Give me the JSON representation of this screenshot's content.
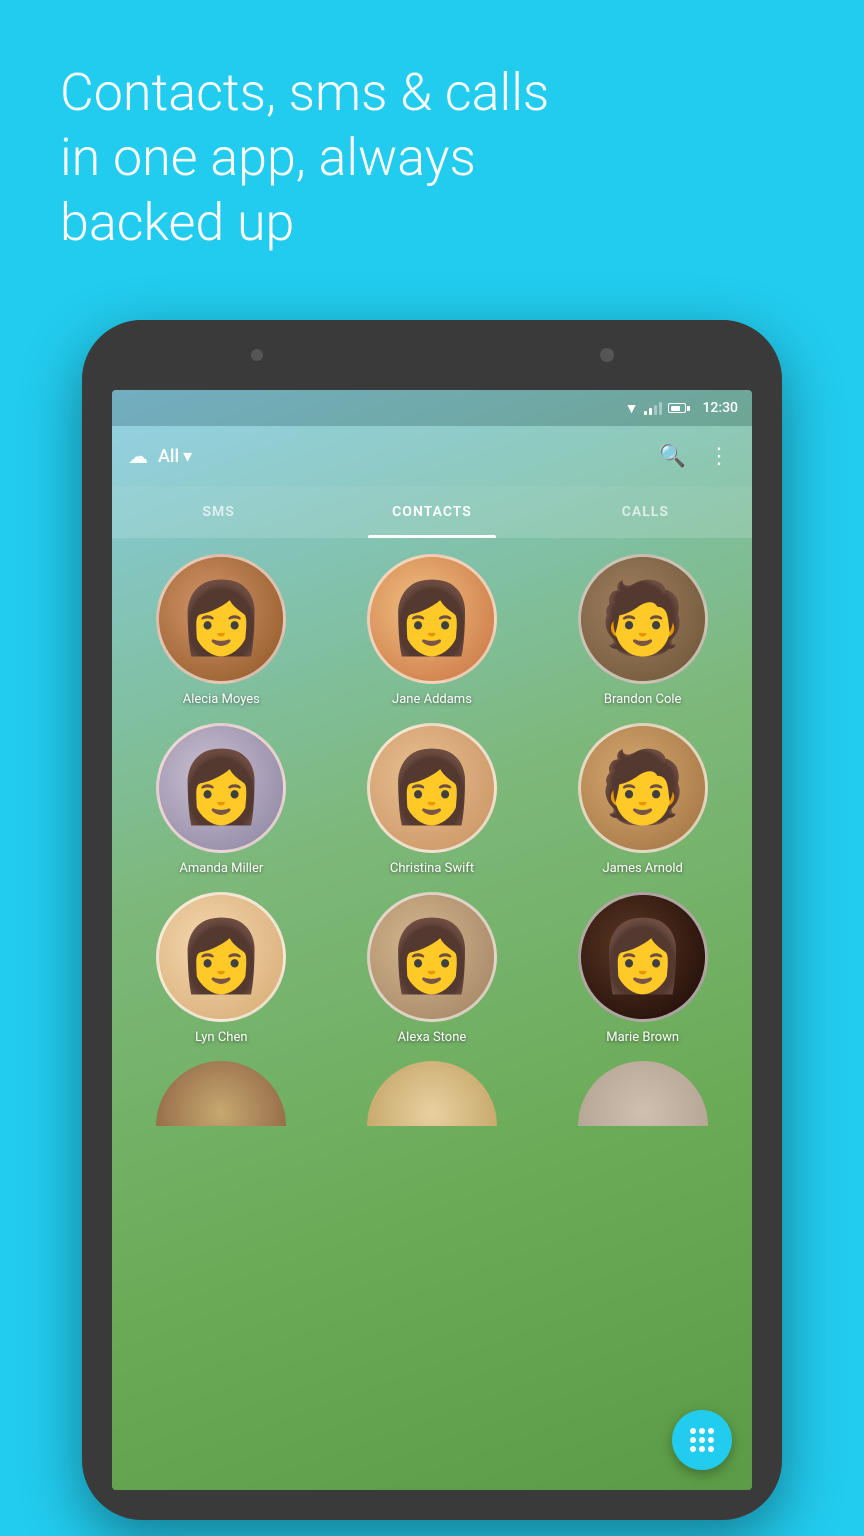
{
  "header": {
    "tagline_line1": "Contacts, sms & calls",
    "tagline_line2": "in one app, always",
    "tagline_line3": "backed up"
  },
  "status_bar": {
    "time": "12:30"
  },
  "app_bar": {
    "filter_label": "All",
    "dropdown_arrow": "▾"
  },
  "tabs": [
    {
      "label": "SMS",
      "active": false
    },
    {
      "label": "CONTACTS",
      "active": true
    },
    {
      "label": "CALLS",
      "active": false
    }
  ],
  "contacts": [
    {
      "name": "Alecia Moyes",
      "avatar_color": "#c97b4b",
      "avatar_bg2": "#8B5523",
      "emoji": "👩"
    },
    {
      "name": "Jane Addams",
      "avatar_color": "#e8a060",
      "avatar_bg2": "#c87840",
      "emoji": "👩"
    },
    {
      "name": "Brandon Cole",
      "avatar_color": "#8B7355",
      "avatar_bg2": "#6B5335",
      "emoji": "🧑"
    },
    {
      "name": "Amanda Miller",
      "avatar_color": "#b0b0c8",
      "avatar_bg2": "#9090a8",
      "emoji": "👩"
    },
    {
      "name": "Christina Swift",
      "avatar_color": "#d4a060",
      "avatar_bg2": "#b48040",
      "emoji": "👩"
    },
    {
      "name": "James Arnold",
      "avatar_color": "#c8a870",
      "avatar_bg2": "#a88850",
      "emoji": "🧑"
    },
    {
      "name": "Lyn Chen",
      "avatar_color": "#f0d0b0",
      "avatar_bg2": "#d0b090",
      "emoji": "👩"
    },
    {
      "name": "Alexa Stone",
      "avatar_color": "#c0a080",
      "avatar_bg2": "#a08060",
      "emoji": "👩"
    },
    {
      "name": "Marie Brown",
      "avatar_color": "#3a2010",
      "avatar_bg2": "#1a1008",
      "emoji": "👩"
    }
  ],
  "fab": {
    "label": "Apps grid"
  }
}
